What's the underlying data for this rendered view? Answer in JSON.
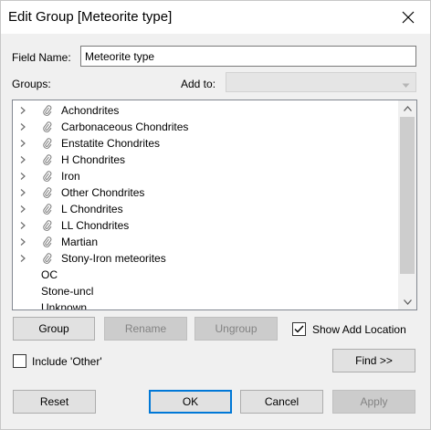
{
  "window": {
    "title": "Edit Group [Meteorite type]",
    "close_icon": "close-icon"
  },
  "field_name": {
    "label": "Field Name:",
    "value": "Meteorite type"
  },
  "groups": {
    "label": "Groups:",
    "add_to_label": "Add to:",
    "add_to_value": "",
    "items": [
      {
        "label": "Achondrites",
        "is_group": true
      },
      {
        "label": "Carbonaceous Chondrites",
        "is_group": true
      },
      {
        "label": "Enstatite Chondrites",
        "is_group": true
      },
      {
        "label": "H Chondrites",
        "is_group": true
      },
      {
        "label": "Iron",
        "is_group": true
      },
      {
        "label": "Other Chondrites",
        "is_group": true
      },
      {
        "label": "L Chondrites",
        "is_group": true
      },
      {
        "label": "LL Chondrites",
        "is_group": true
      },
      {
        "label": "Martian",
        "is_group": true
      },
      {
        "label": "Stony-Iron meteorites",
        "is_group": true
      },
      {
        "label": "OC",
        "is_group": false
      },
      {
        "label": "Stone-uncl",
        "is_group": false
      },
      {
        "label": "Unknown",
        "is_group": false
      }
    ]
  },
  "actions": {
    "group_label": "Group",
    "rename_label": "Rename",
    "ungroup_label": "Ungroup",
    "show_add_location_label": "Show Add Location",
    "show_add_location_checked": true,
    "include_other_label": "Include 'Other'",
    "include_other_checked": false,
    "find_label": "Find >>"
  },
  "footer": {
    "reset_label": "Reset",
    "ok_label": "OK",
    "cancel_label": "Cancel",
    "apply_label": "Apply"
  },
  "colors": {
    "accent": "#0078d7",
    "disabled_bg": "#cccccc",
    "dialog_bg": "#f0f0f0"
  }
}
